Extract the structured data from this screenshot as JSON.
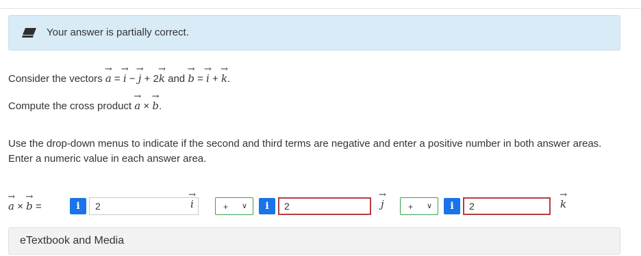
{
  "banner": {
    "text": "Your answer is partially correct.",
    "icon": "pencil-icon",
    "background": "#d9ebf7"
  },
  "question": {
    "line1_prefix": "Consider the vectors",
    "vec_a": "a",
    "vec_i": "i",
    "vec_j": "j",
    "vec_k": "k",
    "vec_b": "b",
    "equals": "=",
    "minus": "−",
    "plus": "+",
    "coef_2": "2",
    "and": "and",
    "period": ".",
    "line2_prefix": "Compute the cross product",
    "times": "×"
  },
  "instructions": "Use the drop-down menus to indicate if the second and third terms are negative and enter a positive number in both answer areas. Enter a numeric value in each answer area.",
  "answer": {
    "info_glyph": "i",
    "first_value": "2",
    "second_sign": "+",
    "second_value": "2",
    "third_sign": "+",
    "third_value": "2",
    "sign_chevron": "∨"
  },
  "etextbook": {
    "label": "eTextbook and Media"
  },
  "colors": {
    "info_badge": "#1a73e8",
    "error_border": "#b53c3c",
    "select_border": "#38a04b"
  }
}
